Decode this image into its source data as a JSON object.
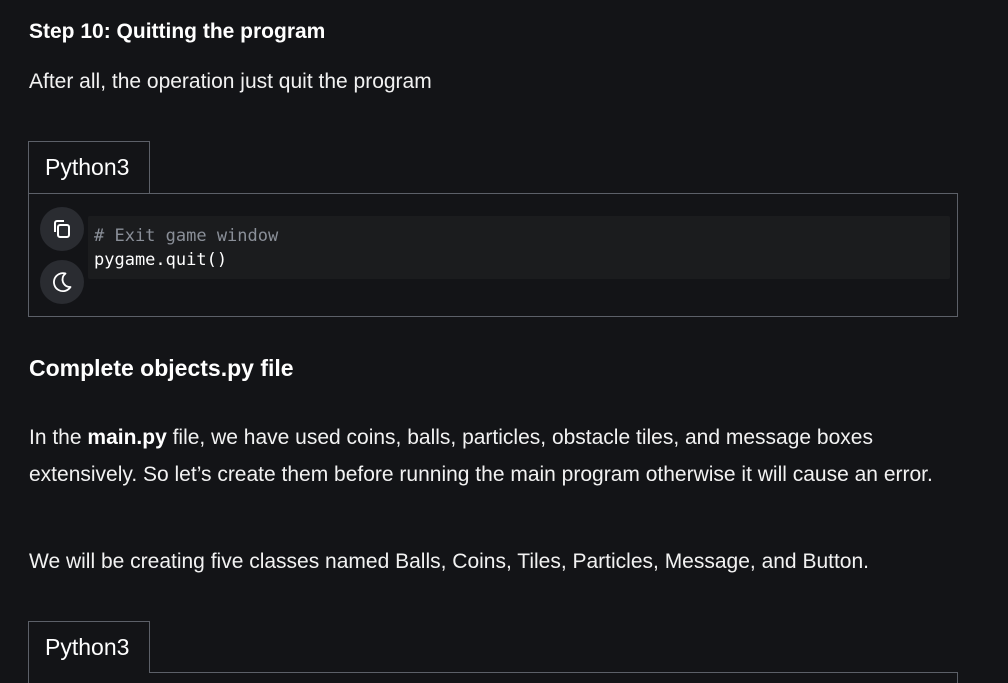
{
  "article": {
    "step_heading": "Step 10: Quitting the program",
    "step_paragraph": "After all, the operation just quit the program",
    "section_heading": "Complete objects.py file",
    "para2_prefix": "In the ",
    "para2_bold": "main.py",
    "para2_rest": " file, we have used coins, balls, particles, obstacle tiles, and message boxes extensively. So let’s create them before running the main program otherwise it will cause an error.",
    "para3": "We will be creating five classes named Balls, Coins, Tiles, Particles, Message, and Button."
  },
  "code_block_1": {
    "language_tab": "Python3",
    "lines": [
      "# Exit game window",
      "pygame.quit()"
    ],
    "copy_icon": "copy-icon",
    "theme_icon": "moon-icon"
  },
  "code_block_2": {
    "language_tab": "Python3"
  },
  "colors": {
    "background": "#131417",
    "border": "#5c6068",
    "code_background": "#1b1c1e",
    "comment": "#8a8f98",
    "icon_button": "#2a2c31"
  }
}
